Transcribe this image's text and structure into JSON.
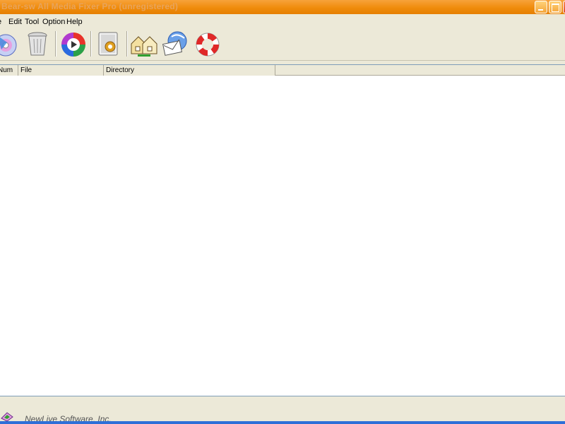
{
  "window": {
    "title": "Bear-sw All Media Fixer Pro (unregistered)"
  },
  "menu": {
    "items": [
      {
        "label": "e"
      },
      {
        "label": "Edit"
      },
      {
        "label": "Tool"
      },
      {
        "label": "Option"
      },
      {
        "label": "Help"
      }
    ]
  },
  "toolbar": {
    "icons": [
      "media-disc-icon",
      "trash-can-icon",
      "color-play-icon",
      "settings-page-icon",
      "home-folder-icon",
      "email-send-icon",
      "help-lifebuoy-icon"
    ]
  },
  "list": {
    "columns": [
      {
        "label": "Num"
      },
      {
        "label": "File"
      },
      {
        "label": "Directory"
      }
    ],
    "rows": []
  },
  "status": {
    "company": "NewLive Software, Inc."
  },
  "colors": {
    "titlebar": "#f08c0c",
    "window_bg": "#ece9d8",
    "list_bg": "#ffffff"
  }
}
